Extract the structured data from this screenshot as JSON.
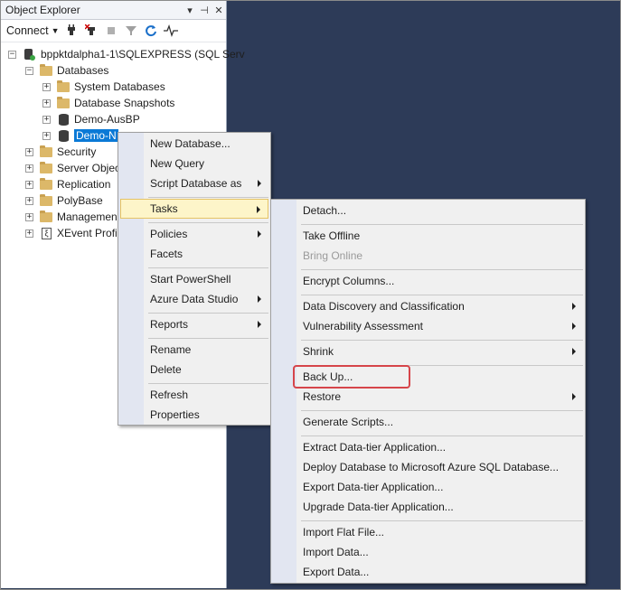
{
  "object_explorer": {
    "title": "Object Explorer",
    "controls": {
      "dropdown": "▾",
      "pin": "⊣",
      "close": "✕"
    },
    "toolbar": {
      "connect_label": "Connect"
    },
    "tree": {
      "server": "bppktdalpha1-1\\SQLEXPRESS (SQL Serv",
      "databases": "Databases",
      "system_databases": "System Databases",
      "database_snapshots": "Database Snapshots",
      "demo_ausbp": "Demo-AusBP",
      "demo_selected": "Demo-N",
      "security": "Security",
      "server_objects": "Server Objec",
      "replication": "Replication",
      "polybase": "PolyBase",
      "management": "Managemen",
      "xevent": "XEvent Profil"
    }
  },
  "context_menu": {
    "items": [
      "New Database...",
      "New Query",
      "Script Database as",
      "Tasks",
      "Policies",
      "Facets",
      "Start PowerShell",
      "Azure Data Studio",
      "Reports",
      "Rename",
      "Delete",
      "Refresh",
      "Properties"
    ]
  },
  "tasks_menu": {
    "items": [
      "Detach...",
      "Take Offline",
      "Bring Online",
      "Encrypt Columns...",
      "Data Discovery and Classification",
      "Vulnerability Assessment",
      "Shrink",
      "Back Up...",
      "Restore",
      "Generate Scripts...",
      "Extract Data-tier Application...",
      "Deploy Database to Microsoft Azure SQL Database...",
      "Export Data-tier Application...",
      "Upgrade Data-tier Application...",
      "Import Flat File...",
      "Import Data...",
      "Export Data..."
    ]
  },
  "colors": {
    "background": "#2d3b58",
    "selection": "#0a79d6",
    "highlight": "#fdf5c9",
    "callout": "#d6454a"
  }
}
